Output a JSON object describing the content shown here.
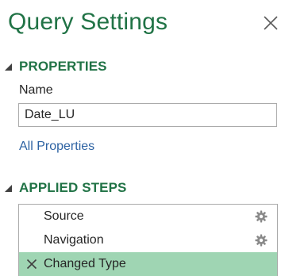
{
  "pane": {
    "title": "Query Settings"
  },
  "properties": {
    "header": "PROPERTIES",
    "name_label": "Name",
    "name_value": "Date_LU",
    "all_properties_link": "All Properties"
  },
  "applied_steps": {
    "header": "APPLIED STEPS",
    "steps": [
      {
        "label": "Source",
        "has_settings": true,
        "selected": false
      },
      {
        "label": "Navigation",
        "has_settings": true,
        "selected": false
      },
      {
        "label": "Changed Type",
        "has_settings": false,
        "selected": true
      }
    ]
  },
  "colors": {
    "accent": "#217346",
    "link": "#2e63a3",
    "selected_step": "#9fd5b3"
  },
  "icons": {
    "close": "close-icon",
    "collapse": "caret-down-icon",
    "settings": "gear-icon",
    "delete_step": "delete-step-icon"
  }
}
